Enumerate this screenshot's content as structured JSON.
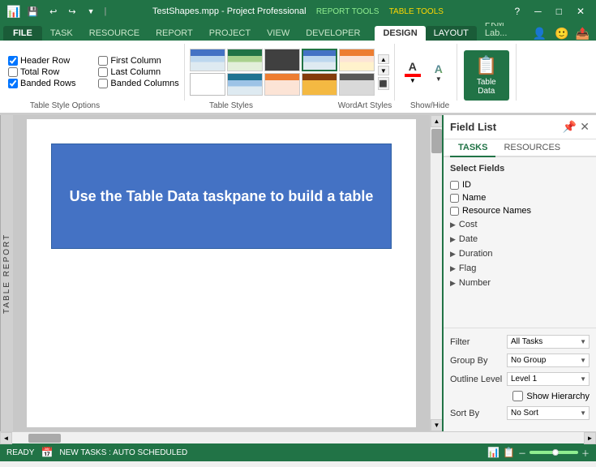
{
  "title_bar": {
    "app_title": "TestShapes.mpp - Project Professional",
    "report_tools_label": "REPORT TOOLS",
    "table_tools_label": "TABLE TOOLS",
    "help_btn": "?",
    "minimize_btn": "─",
    "restore_btn": "□",
    "close_btn": "✕"
  },
  "tabs": {
    "file": "FILE",
    "task": "TASK",
    "resource": "RESOURCE",
    "report": "REPORT",
    "project": "PROJECT",
    "view": "VIEW",
    "developer": "DEVELOPER",
    "design_report": "DESIGN",
    "design_table": "DESIGN",
    "layout": "LAYOUT",
    "pkm": "PKM Lab..."
  },
  "ribbon": {
    "table_style_options_label": "Table Style Options",
    "table_styles_label": "Table Styles",
    "wordart_label": "WordArt Styles",
    "show_hide_label": "Show/Hide",
    "checkboxes": {
      "header_row": "Header Row",
      "first_column": "First Column",
      "total_row": "Total Row",
      "last_column": "Last Column",
      "banded_rows": "Banded Rows",
      "banded_columns": "Banded Columns"
    },
    "table_data_btn": "Table\nData"
  },
  "canvas": {
    "blue_box_text": "Use the Table Data taskpane to build a table",
    "vertical_label": "TABLE REPORT"
  },
  "field_list": {
    "title": "Field List",
    "close_btn": "✕",
    "pin_btn": "📌",
    "tabs": {
      "tasks": "TASKS",
      "resources": "RESOURCES"
    },
    "select_fields_label": "Select Fields",
    "fields": [
      {
        "id": "id",
        "label": "ID",
        "checked": false
      },
      {
        "id": "name",
        "label": "Name",
        "checked": false
      },
      {
        "id": "resource_names",
        "label": "Resource Names",
        "checked": false
      }
    ],
    "groups": [
      {
        "label": "Cost"
      },
      {
        "label": "Date"
      },
      {
        "label": "Duration"
      },
      {
        "label": "Flag"
      },
      {
        "label": "Number"
      }
    ],
    "filter_label": "Filter",
    "filter_value": "All Tasks",
    "group_by_label": "Group By",
    "group_by_value": "No Group",
    "outline_level_label": "Outline Level",
    "outline_level_value": "Level 1",
    "show_hierarchy_label": "Show Hierarchy",
    "sort_by_label": "Sort By",
    "sort_by_value": "No Sort"
  },
  "status_bar": {
    "ready": "READY",
    "new_tasks": "NEW TASKS : AUTO SCHEDULED"
  }
}
